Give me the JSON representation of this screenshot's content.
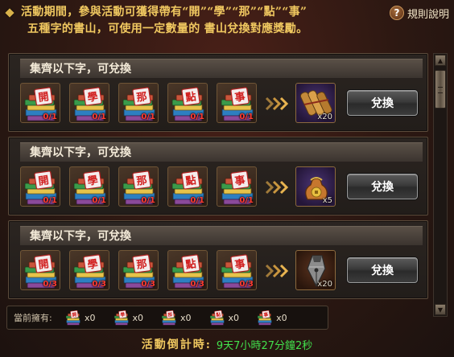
{
  "header": {
    "description_line1": "活動期間，參與活動可獲得帶有“開”“學”“那”“點”“事”",
    "description_line2": "五種字的書山，可使用一定數量的 書山兌換對應獎勵。",
    "help_label": "規則說明",
    "help_icon": "question-icon"
  },
  "cards": [
    {
      "title": "集齊以下字，可兌換",
      "items": [
        {
          "char": "開",
          "count": "0/1"
        },
        {
          "char": "學",
          "count": "0/1"
        },
        {
          "char": "那",
          "count": "0/1"
        },
        {
          "char": "點",
          "count": "0/1"
        },
        {
          "char": "事",
          "count": "0/1"
        }
      ],
      "reward": {
        "icon": "scroll-bundle-icon",
        "count": "x20",
        "style": "purple"
      },
      "button": "兌換"
    },
    {
      "title": "集齊以下字，可兌換",
      "items": [
        {
          "char": "開",
          "count": "0/1"
        },
        {
          "char": "學",
          "count": "0/1"
        },
        {
          "char": "那",
          "count": "0/1"
        },
        {
          "char": "點",
          "count": "0/1"
        },
        {
          "char": "事",
          "count": "0/1"
        }
      ],
      "reward": {
        "icon": "money-bag-icon",
        "count": "x5",
        "style": "purple"
      },
      "button": "兌換"
    },
    {
      "title": "集齊以下字，可兌換",
      "items": [
        {
          "char": "開",
          "count": "0/3"
        },
        {
          "char": "學",
          "count": "0/3"
        },
        {
          "char": "那",
          "count": "0/3"
        },
        {
          "char": "點",
          "count": "0/3"
        },
        {
          "char": "事",
          "count": "0/3"
        }
      ],
      "reward": {
        "icon": "pen-nib-icon",
        "count": "x20",
        "style": "brown"
      },
      "button": "兌換"
    }
  ],
  "owned": {
    "label": "當前擁有:",
    "items": [
      {
        "char": "開",
        "count": "x0"
      },
      {
        "char": "學",
        "count": "x0"
      },
      {
        "char": "那",
        "count": "x0"
      },
      {
        "char": "點",
        "count": "x0"
      },
      {
        "char": "事",
        "count": "x0"
      }
    ]
  },
  "countdown": {
    "label": "活動倒計時:",
    "value": "9天7小時27分鐘2秒"
  },
  "colors": {
    "accent_gold": "#f0c860",
    "count_red": "#ff3b2f",
    "countdown_green": "#42e04c"
  }
}
